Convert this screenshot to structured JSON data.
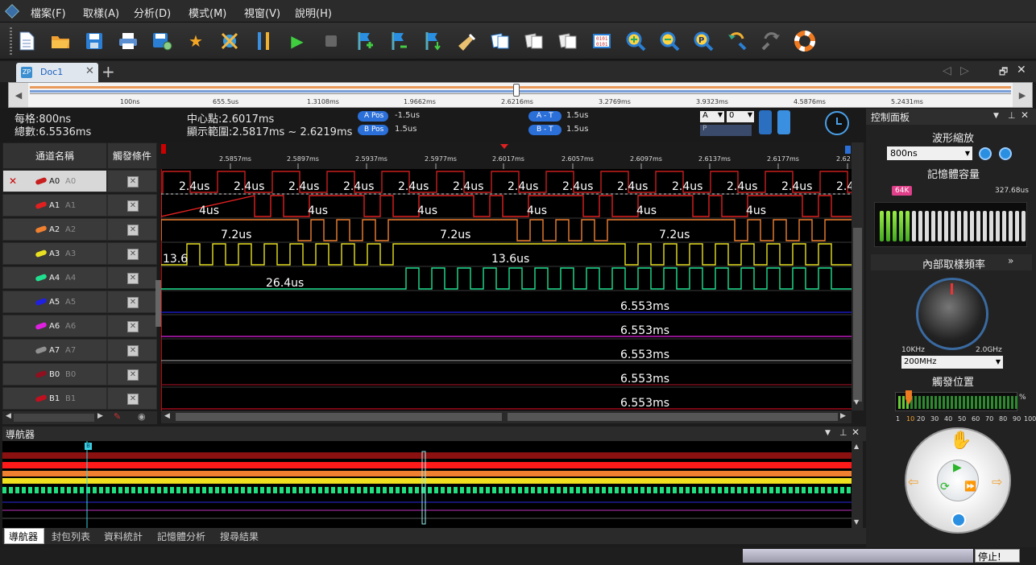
{
  "menu": [
    "檔案(F)",
    "取樣(A)",
    "分析(D)",
    "模式(M)",
    "視窗(V)",
    "說明(H)"
  ],
  "toolbar_icons": [
    "new-file-icon",
    "open-folder-icon",
    "save-icon",
    "print-icon",
    "save-settings-icon",
    "favorite-star-icon",
    "device-icon",
    "tools-icon",
    "run-icon",
    "stop-icon",
    "add-marker-icon",
    "remove-marker-icon",
    "marker-down-icon",
    "flashlight-icon",
    "copy-icon",
    "paste-icon",
    "paste2-icon",
    "binary-icon",
    "zoom-in-icon",
    "zoom-out-icon",
    "zoom-fit-icon",
    "back-icon",
    "forward-icon",
    "lifebuoy-icon"
  ],
  "tab": {
    "label": "Doc1",
    "add": "+"
  },
  "timeline": {
    "labels": [
      "100ns",
      "655.5us",
      "1.3108ms",
      "1.9662ms",
      "2.6216ms",
      "3.2769ms",
      "3.9323ms",
      "4.5876ms",
      "5.2431ms"
    ],
    "position": 0.5
  },
  "info": {
    "per_div": "每格:800ns",
    "total": "總數:6.5536ms",
    "center": "中心點:2.6017ms",
    "range": "顯示範圍:2.5817ms ~ 2.6219ms",
    "a_pos_label": "A Pos",
    "a_pos_value": "-1.5us",
    "b_pos_label": "B Pos",
    "b_pos_value": "1.5us",
    "a_t_label": "A - T",
    "a_t_value": "1.5us",
    "b_t_label": "B - T",
    "b_t_value": "1.5us",
    "select_a": "A",
    "select_0": "0",
    "p_label": "P"
  },
  "channel_header": "通道名稱",
  "trigger_header": "觸發條件",
  "channels": [
    {
      "name": "A0",
      "alias": "A0",
      "color": "#c81e1e",
      "selected": true
    },
    {
      "name": "A1",
      "alias": "A1",
      "color": "#e02020"
    },
    {
      "name": "A2",
      "alias": "A2",
      "color": "#f08030"
    },
    {
      "name": "A3",
      "alias": "A3",
      "color": "#e8e020"
    },
    {
      "name": "A4",
      "alias": "A4",
      "color": "#20e090"
    },
    {
      "name": "A5",
      "alias": "A5",
      "color": "#2020e0"
    },
    {
      "name": "A6",
      "alias": "A6",
      "color": "#e020e0"
    },
    {
      "name": "A7",
      "alias": "A7",
      "color": "#909090"
    },
    {
      "name": "B0",
      "alias": "B0",
      "color": "#901020"
    },
    {
      "name": "B1",
      "alias": "B1",
      "color": "#c01020"
    }
  ],
  "ruler_labels": [
    "2.5857ms",
    "2.5897ms",
    "2.5937ms",
    "2.5977ms",
    "2.6017ms",
    "2.6057ms",
    "2.6097ms",
    "2.6137ms",
    "2.6177ms",
    "2.62"
  ],
  "wave_labels": {
    "a0": "2.4us",
    "a1": "4us",
    "a2": "7.2us",
    "a3_left": "13.6",
    "a3": "13.6us",
    "a4": "26.4us",
    "flat": "6.553ms"
  },
  "panel": {
    "title": "控制面板",
    "zoom_title": "波形縮放",
    "zoom_value": "800ns",
    "memory_title": "記憶體容量",
    "memory_badge": "64K",
    "memory_time": "327.68us",
    "memory_level": 0.1,
    "rate_title": "內部取樣頻率",
    "rate_min": "10KHz",
    "rate_max": "2.0GHz",
    "rate_value": "200MHz",
    "trigger_title": "觸發位置",
    "trigger_unit": "%",
    "trigger_ticks": [
      "1",
      "10",
      "20",
      "30",
      "40",
      "50",
      "60",
      "70",
      "80",
      "90",
      "100"
    ],
    "trigger_selected": "10"
  },
  "navigator": {
    "title": "導航器",
    "marker": "B"
  },
  "bottom_tabs": [
    "導航器",
    "封包列表",
    "資料統計",
    "記憶體分析",
    "搜尋結果"
  ],
  "status": {
    "stop": "停止!"
  }
}
